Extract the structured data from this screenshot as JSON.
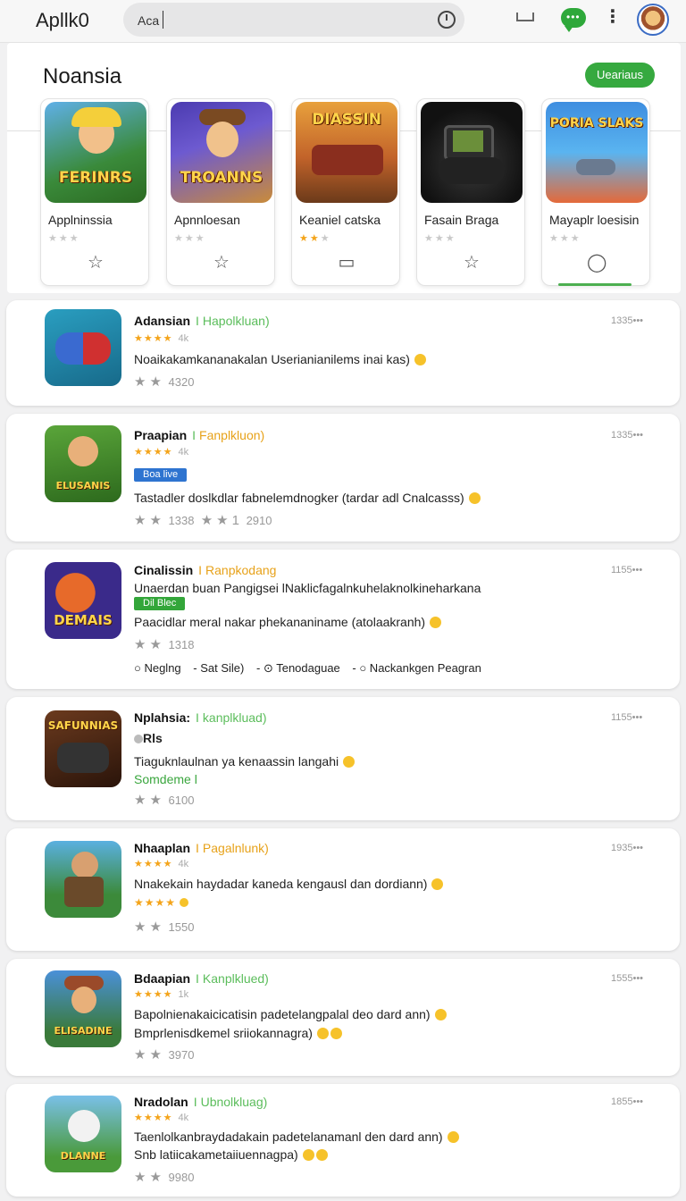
{
  "topbar": {
    "app_title": "Apllk0",
    "search_value": "Aca",
    "icons": [
      "clock-icon",
      "device-icon",
      "chat-icon",
      "kebab-icon",
      "avatar"
    ],
    "chat_dots": "•••",
    "kebab": "⋮",
    "accent": "#2ea83a"
  },
  "featured": {
    "title": "Noansia",
    "see_all_label": "Ueariaus",
    "tiles": [
      {
        "name": "Applninssia",
        "art_label": "FERINRS",
        "action_icon": "star-outline-icon",
        "action": "☆"
      },
      {
        "name": "Apnnloesan",
        "art_label": "TROANNS",
        "action_icon": "star-outline-icon",
        "action": "☆"
      },
      {
        "name": "Keaniel catska",
        "art_label": "DIASSIN",
        "action_icon": "bookmark-icon",
        "action": "▭"
      },
      {
        "name": "Fasain Braga",
        "art_label": "",
        "action_icon": "star-outline-icon",
        "action": "☆"
      },
      {
        "name": "Mayaplr loesisin",
        "art_label": "PORIA SLAKS",
        "action_icon": "comment-icon",
        "action": "◯"
      }
    ]
  },
  "list": [
    {
      "title": "Adansian",
      "category": "Hapolkluan)",
      "size": "1335•••",
      "rating_stars": "★★★★",
      "rating_num": "4k",
      "desc": "Noaikakamkananakalan Userianianilems inai kas)",
      "foot_stars": "★★",
      "foot_num": "4320",
      "icon_label": ""
    },
    {
      "title": "Praapian",
      "category": "Fanplkluon)",
      "size": "1335•••",
      "rating_stars": "★★★★",
      "rating_num": "4k",
      "badge": "Boa live",
      "desc": "Tastadler doslkdlar fabnelemdnogker (tardar adl Cnalcasss)",
      "foot_stars": "★★",
      "foot_num": "1338",
      "foot_extra_stars": "★★1",
      "foot_extra_num": "2910",
      "icon_label": "ELUSANIS"
    },
    {
      "title": "Cinalissin",
      "category": "Ranpkodang",
      "size": "1155•••",
      "sub": "Unaerdan buan Pangigsei lNaklicfagalnkuhelaknolkineharkana",
      "badge": "Dil Blec",
      "desc": "Paacidlar meral nakar phekananiname (atolaakranh)",
      "foot_stars": "★★",
      "foot_num": "1318",
      "options": [
        "○ Neglng",
        "- Sat Sile)",
        "- ⊙ Tenodaguae",
        "- ○ Nackankgen Peagran"
      ],
      "icon_label": "DEMAIS"
    },
    {
      "title": "Nplahsia:",
      "category": "kanplkluad)",
      "size": "1155•••",
      "sub": "Rls",
      "desc": "Tiaguknlaulnan ya kenaassin langahi",
      "sub2": "Somdeme l",
      "foot_stars": "★★",
      "foot_num": "6100",
      "icon_label": "SAFUNNIAS"
    },
    {
      "title": "Nhaaplan",
      "category": "Pagalnlunk)",
      "size": "1935•••",
      "rating_stars": "★★★★",
      "rating_num": "4k",
      "desc": "Nnakekain haydadar kaneda kengausl dan dordiann)",
      "rating2": "★★★★",
      "foot_stars": "★★",
      "foot_num": "1550",
      "icon_label": ""
    },
    {
      "title": "Bdaapian",
      "category": "Kanplklued)",
      "size": "1555•••",
      "rating_stars": "★★★★",
      "rating_num": "1k",
      "desc": "Bapolnienakaicicatisin padetelangpalal deo dard ann)",
      "desc2": "Bmprlenisdkemel sriiokannagra)",
      "foot_stars": "★★",
      "foot_num": "3970",
      "icon_label": "ELISADINE"
    },
    {
      "title": "Nradolan",
      "category": "Ubnolkluag)",
      "size": "1855•••",
      "rating_stars": "★★★★",
      "rating_num": "4k",
      "desc": "Taenlolkanbraydadakain padetelanamanl den dard ann)",
      "desc2": "Snb latiicakametaiiuennagpa)",
      "foot_stars": "★★",
      "foot_num": "9980",
      "icon_label": "DLANNE"
    }
  ]
}
